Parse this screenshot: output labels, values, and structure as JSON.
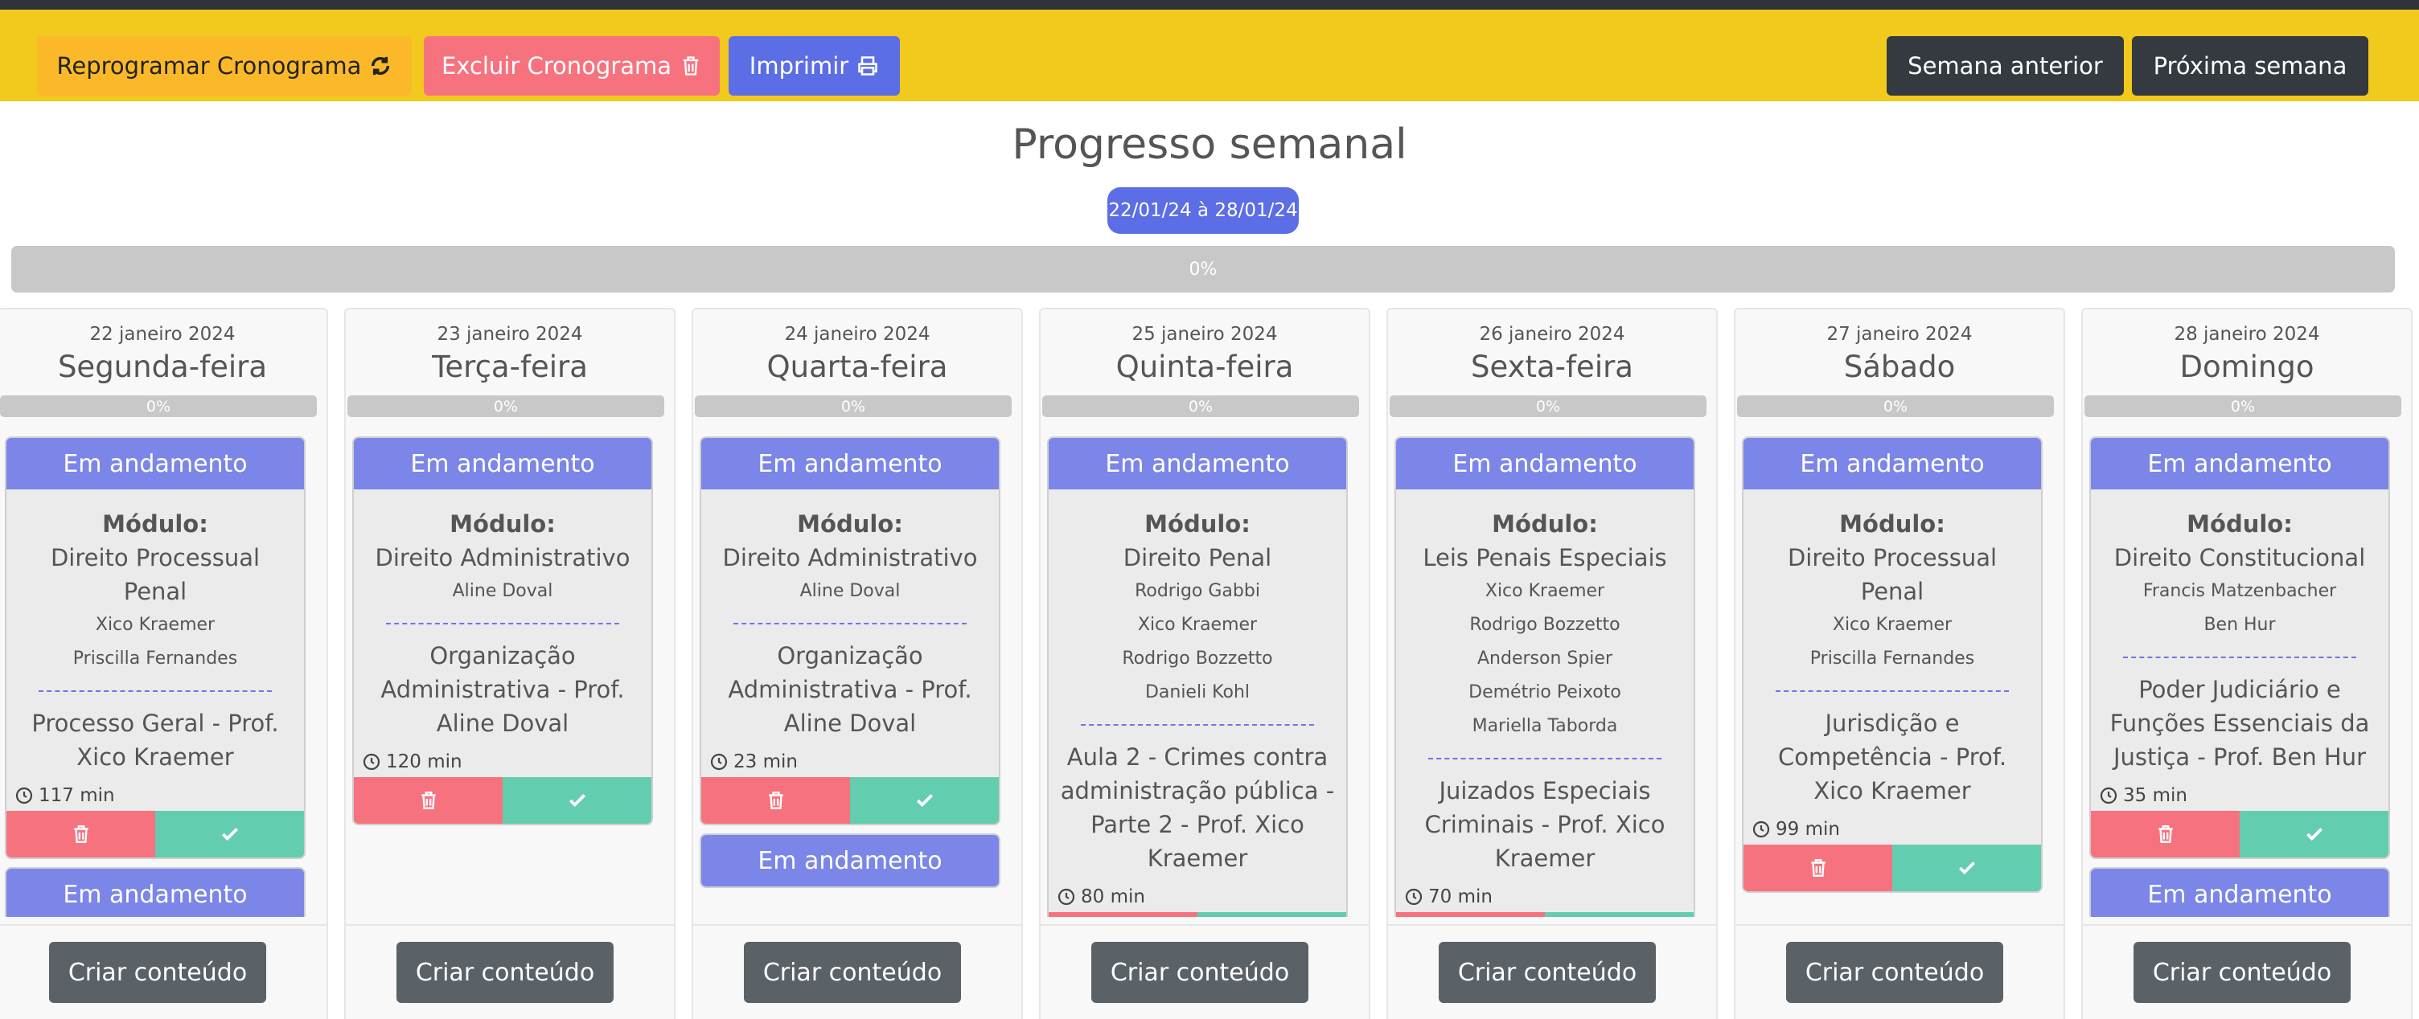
{
  "toolbar": {
    "reprogram_label": "Reprogramar Cronograma",
    "delete_label": "Excluir Cronograma",
    "print_label": "Imprimir",
    "prev_week_label": "Semana anterior",
    "next_week_label": "Próxima semana"
  },
  "progress": {
    "title": "Progresso semanal",
    "range": "22/01/24 à 28/01/24",
    "percent_label": "0%",
    "percent_value": 0
  },
  "days": [
    {
      "date": "22 janeiro 2024",
      "name": "Segunda-feira",
      "percent_label": "0%",
      "card": {
        "status": "Em andamento",
        "module_label": "Módulo:",
        "module": "Direito Processual Penal",
        "professors": [
          "Xico Kraemer",
          "Priscilla Fernandes"
        ],
        "topic": "Processo Geral - Prof. Xico Kraemer",
        "time": "117 min"
      },
      "extra_status": "Em andamento",
      "create_label": "Criar conteúdo"
    },
    {
      "date": "23 janeiro 2024",
      "name": "Terça-feira",
      "percent_label": "0%",
      "card": {
        "status": "Em andamento",
        "module_label": "Módulo:",
        "module": "Direito Administrativo",
        "professors": [
          "Aline Doval"
        ],
        "topic": "Organização Administrativa - Prof. Aline Doval",
        "time": "120 min"
      },
      "create_label": "Criar conteúdo"
    },
    {
      "date": "24 janeiro 2024",
      "name": "Quarta-feira",
      "percent_label": "0%",
      "card": {
        "status": "Em andamento",
        "module_label": "Módulo:",
        "module": "Direito Administrativo",
        "professors": [
          "Aline Doval"
        ],
        "topic": "Organização Administrativa - Prof. Aline Doval",
        "time": "23 min"
      },
      "extra_status": "Em andamento",
      "create_label": "Criar conteúdo"
    },
    {
      "date": "25 janeiro 2024",
      "name": "Quinta-feira",
      "percent_label": "0%",
      "card": {
        "status": "Em andamento",
        "module_label": "Módulo:",
        "module": "Direito Penal",
        "professors": [
          "Rodrigo Gabbi",
          "Xico Kraemer",
          "Rodrigo Bozzetto",
          "Danieli Kohl"
        ],
        "topic": "Aula 2 - Crimes contra administração pública - Parte 2 - Prof. Xico Kraemer",
        "time": "80 min"
      },
      "create_label": "Criar conteúdo"
    },
    {
      "date": "26 janeiro 2024",
      "name": "Sexta-feira",
      "percent_label": "0%",
      "card": {
        "status": "Em andamento",
        "module_label": "Módulo:",
        "module": "Leis Penais Especiais",
        "professors": [
          "Xico Kraemer",
          "Rodrigo Bozzetto",
          "Anderson Spier",
          "Demétrio Peixoto",
          "Mariella Taborda"
        ],
        "topic": "Juizados Especiais Criminais - Prof. Xico Kraemer",
        "time": "70 min"
      },
      "create_label": "Criar conteúdo"
    },
    {
      "date": "27 janeiro 2024",
      "name": "Sábado",
      "percent_label": "0%",
      "card": {
        "status": "Em andamento",
        "module_label": "Módulo:",
        "module": "Direito Processual Penal",
        "professors": [
          "Xico Kraemer",
          "Priscilla Fernandes"
        ],
        "topic": "Jurisdição e Competência - Prof. Xico Kraemer",
        "time": "99 min"
      },
      "create_label": "Criar conteúdo"
    },
    {
      "date": "28 janeiro 2024",
      "name": "Domingo",
      "percent_label": "0%",
      "card": {
        "status": "Em andamento",
        "module_label": "Módulo:",
        "module": "Direito Constitucional",
        "professors": [
          "Francis Matzenbacher",
          "Ben Hur"
        ],
        "topic": "Poder Judiciário e Funções Essenciais da Justiça - Prof. Ben Hur",
        "time": "35 min"
      },
      "extra_status": "Em andamento",
      "create_label": "Criar conteúdo"
    }
  ],
  "colors": {
    "toolbar_bg": "#f2c91d",
    "primary": "#5c6ee6",
    "danger": "#f7727f",
    "success": "#63cdb0",
    "dark": "#343a40",
    "card_header": "#7b86e8"
  }
}
